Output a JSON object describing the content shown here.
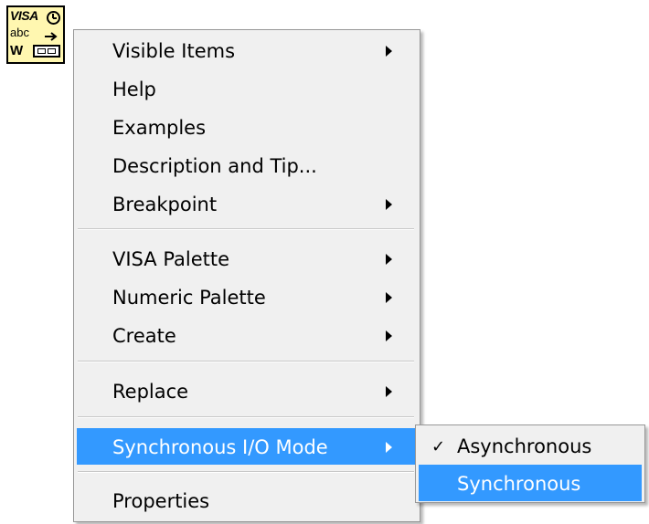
{
  "node_icon": {
    "name": "visa-write-icon",
    "text_top": "VISA",
    "text_middle": "abc",
    "text_bottom": "W"
  },
  "context_menu": {
    "items": [
      {
        "label": "Visible Items",
        "submenu": true
      },
      {
        "label": "Help",
        "submenu": false
      },
      {
        "label": "Examples",
        "submenu": false
      },
      {
        "label": "Description and Tip...",
        "submenu": false
      },
      {
        "label": "Breakpoint",
        "submenu": true
      },
      {
        "label": "VISA Palette",
        "submenu": true
      },
      {
        "label": "Numeric Palette",
        "submenu": true
      },
      {
        "label": "Create",
        "submenu": true
      },
      {
        "label": "Replace",
        "submenu": true
      },
      {
        "label": "Synchronous I/O Mode",
        "submenu": true,
        "highlighted": true
      },
      {
        "label": "Properties",
        "submenu": false
      }
    ]
  },
  "submenu": {
    "items": [
      {
        "label": "Asynchronous",
        "checked": true,
        "check_glyph": "✓"
      },
      {
        "label": "Synchronous",
        "checked": false,
        "highlighted": true
      }
    ]
  },
  "colors": {
    "menu_background": "#f0f0f0",
    "highlight": "#3399ff",
    "highlight_text": "#ffffff",
    "icon_background": "#fff7b0"
  }
}
